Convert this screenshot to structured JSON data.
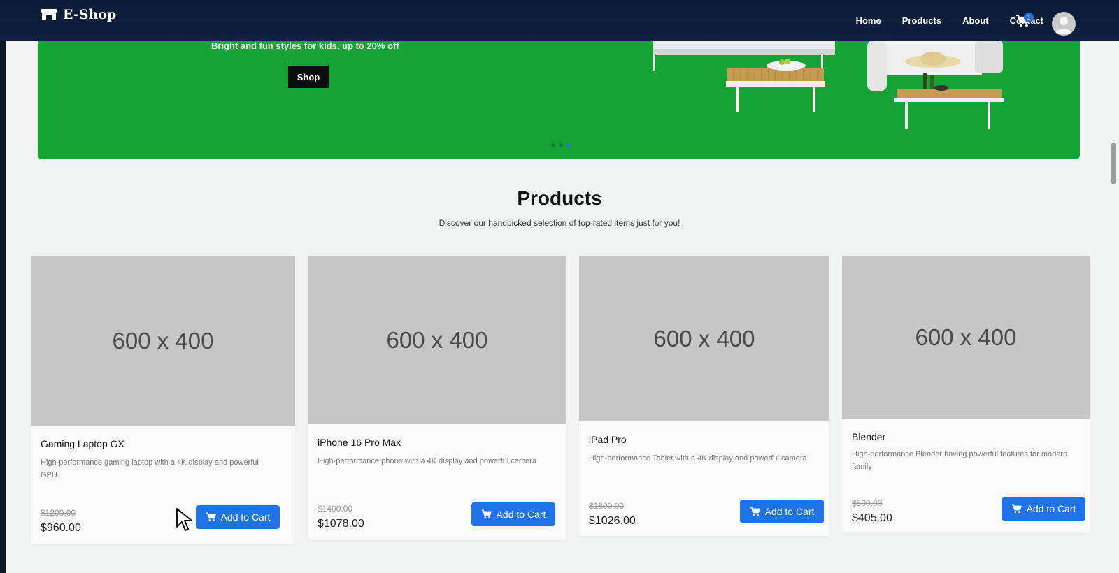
{
  "brand": {
    "name": "E-Shop",
    "icon": "store-icon"
  },
  "nav": {
    "links": [
      "Home",
      "Products",
      "About",
      "Contact"
    ],
    "cart_count": "1",
    "cart_icon": "cart-icon",
    "avatar_icon": "user-avatar-icon"
  },
  "banner": {
    "tagline": "Bright and fun styles for kids, up to 20% off",
    "button_label": "Shop",
    "background_color": "#16a336",
    "slide_count": 3,
    "active_slide": 3
  },
  "products_section": {
    "title": "Products",
    "subtitle": "Discover our handpicked selection of top-rated items just for you!"
  },
  "products": [
    {
      "image_placeholder": "600 x 400",
      "name": "Gaming Laptop GX",
      "description": "High-performance gaming laptop with a 4K display and powerful GPU",
      "old_price": "$1200.00",
      "price": "$960.00",
      "button_label": "Add to Cart"
    },
    {
      "image_placeholder": "600 x 400",
      "name": "iPhone 16 Pro Max",
      "description": "High-performance phone with a 4K display and powerful camera",
      "old_price": "$1400.00",
      "price": "$1078.00",
      "button_label": "Add to Cart"
    },
    {
      "image_placeholder": "600 x 400",
      "name": "iPad Pro",
      "description": "High-performance Tablet with a 4K display and powerful camera",
      "old_price": "$1800.00",
      "price": "$1026.00",
      "button_label": "Add to Cart"
    },
    {
      "image_placeholder": "600 x 400",
      "name": "Blender",
      "description": "High-performance Blender having powerful features for modern family",
      "old_price": "$500.00",
      "price": "$405.00",
      "button_label": "Add to Cart"
    }
  ],
  "colors": {
    "navbar": "#0a1b34",
    "accent_button": "#1f73e6",
    "image_placeholder": "#c6c6c6"
  }
}
